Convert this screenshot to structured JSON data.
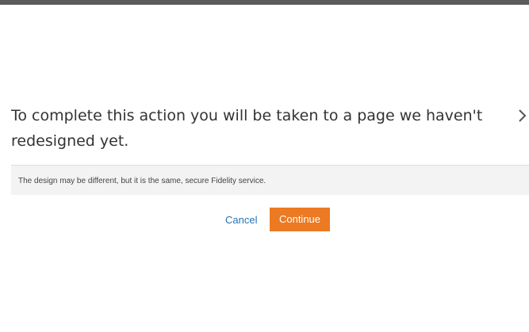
{
  "dialog": {
    "title": "To complete this action you will be taken to a page we haven't redesigned yet.",
    "info": "The design may be different, but it is the same, secure Fidelity service.",
    "close_icon": "close-icon",
    "cancel_label": "Cancel",
    "continue_label": "Continue"
  },
  "colors": {
    "accent": "#ec7a23",
    "link": "#2a72b5",
    "top_bar": "#5b5b5b",
    "info_background": "#f3f3f3"
  }
}
